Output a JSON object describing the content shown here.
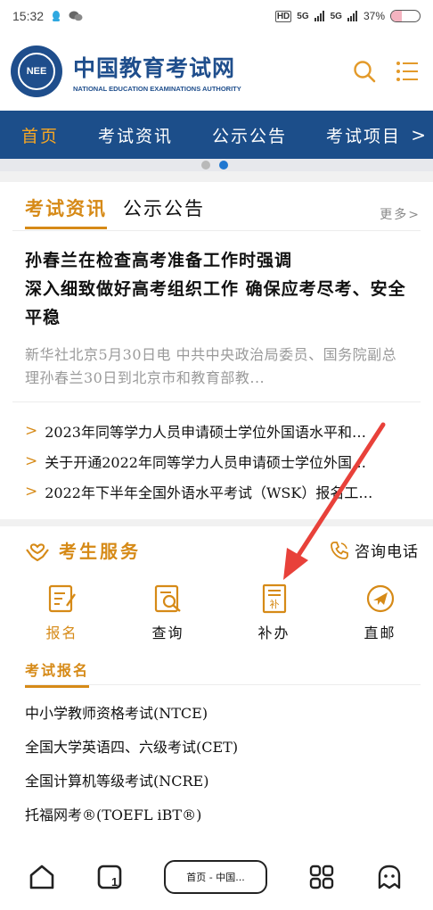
{
  "status": {
    "time": "15:32",
    "signal1": "HD",
    "signal2": "5G",
    "signal3": "5G",
    "battery": "37%",
    "battery_level": 0.37
  },
  "header": {
    "logo_badge": "NEE",
    "title": "中国教育考试网",
    "subtitle": "NATIONAL EDUCATION EXAMINATIONS AUTHORITY"
  },
  "nav": {
    "items": [
      "首页",
      "考试资讯",
      "公示公告",
      "考试项目"
    ],
    "more": ">"
  },
  "news": {
    "tab_news": "考试资讯",
    "tab_notice": "公示公告",
    "more": "更多>",
    "headline_1": "孙春兰在检查高考准备工作时强调",
    "headline_2": "深入细致做好高考组织工作 确保应考尽考、安全平稳",
    "summary": "新华社北京5月30日电 中共中央政治局委员、国务院副总理孙春兰30日到北京市和教育部教...",
    "items": [
      "2023年同等学力人员申请硕士学位外国语水平和…",
      "关于开通2022年同等学力人员申请硕士学位外国…",
      "2022年下半年全国外语水平考试（WSK）报名工…"
    ]
  },
  "service": {
    "title": "考生服务",
    "hotline": "咨询电话",
    "items": [
      "报名",
      "查询",
      "补办",
      "直邮"
    ]
  },
  "registration": {
    "tab": "考试报名",
    "exams": [
      "中小学教师资格考试(NTCE)",
      "全国大学英语四、六级考试(CET)",
      "全国计算机等级考试(NCRE)",
      "托福网考®(TOEFL iBT®)"
    ]
  },
  "bottom": {
    "url": "首页 - 中国..."
  },
  "colors": {
    "brand_blue": "#1c4e8a",
    "accent_orange": "#d68a17",
    "nav_active": "#f6a623",
    "annotation_red": "#e8413a"
  }
}
